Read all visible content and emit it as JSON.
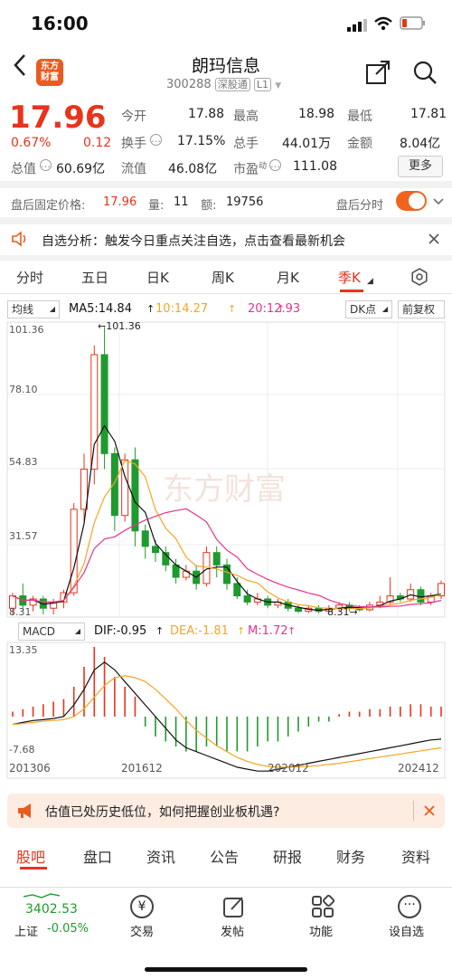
{
  "status": {
    "time": "16:00"
  },
  "header": {
    "logo_text": "东方\n财富",
    "title": "朗玛信息",
    "code": "300288",
    "tag1": "深股通",
    "tag2": "L1"
  },
  "quote": {
    "price": "17.96",
    "change_pct": "0.67%",
    "change": "0.12",
    "labels": {
      "open": "今开",
      "high": "最高",
      "low": "最低",
      "turnover": "换手",
      "volume": "总手",
      "amount": "金额",
      "mcap": "总值",
      "float": "流值",
      "pe": "市盈",
      "pe_sup": "动"
    },
    "open": "17.88",
    "high": "18.98",
    "low": "17.81",
    "turnover": "17.15%",
    "volume": "44.01万",
    "amount": "8.04亿",
    "mcap": "60.69亿",
    "float": "46.08亿",
    "pe": "111.08",
    "more": "更多"
  },
  "afterhours": {
    "label": "盘后固定价格:",
    "price": "17.96",
    "vol_label": "量:",
    "vol": "11",
    "amt_label": "额:",
    "amt": "19756",
    "right_label": "盘后分时"
  },
  "banner": {
    "text": "自选分析：触发今日重点关注自选，点击查看最新机会"
  },
  "tabs": [
    "分时",
    "五日",
    "日K",
    "周K",
    "月K",
    "季K"
  ],
  "chart": {
    "indicator": "均线",
    "ma5": "MA5:14.84",
    "ma10": "10:14.27",
    "ma20": "20:12.93",
    "dk": "DK点",
    "adjust": "前复权",
    "peak_label": "101.36",
    "y_ticks": [
      "101.36",
      "78.10",
      "54.83",
      "31.57",
      "8.31"
    ],
    "low_label": "8.31",
    "macd_label": "MACD",
    "dif": "DIF:-0.95",
    "dea": "DEA:-1.81",
    "m": "M:1.72",
    "macd_ticks": [
      "13.35",
      "-7.68"
    ],
    "x_ticks": [
      "201306",
      "201612",
      "202012",
      "202412"
    ],
    "watermark": "东方财富",
    "colors": {
      "up": "#e8341c",
      "down": "#1f9a2e",
      "ma5": "#111111",
      "ma10": "#f5a623",
      "ma20": "#e6348f"
    }
  },
  "promo": {
    "text": "估值已处历史低位，如何把握创业板机遇?"
  },
  "bottom_tabs": [
    "股吧",
    "盘口",
    "资讯",
    "公告",
    "研报",
    "财务",
    "资料"
  ],
  "footer": {
    "index_value": "3402.53",
    "index_name": "上证",
    "index_change": "-0.05%",
    "items": [
      "交易",
      "发帖",
      "功能",
      "设自选"
    ]
  }
}
